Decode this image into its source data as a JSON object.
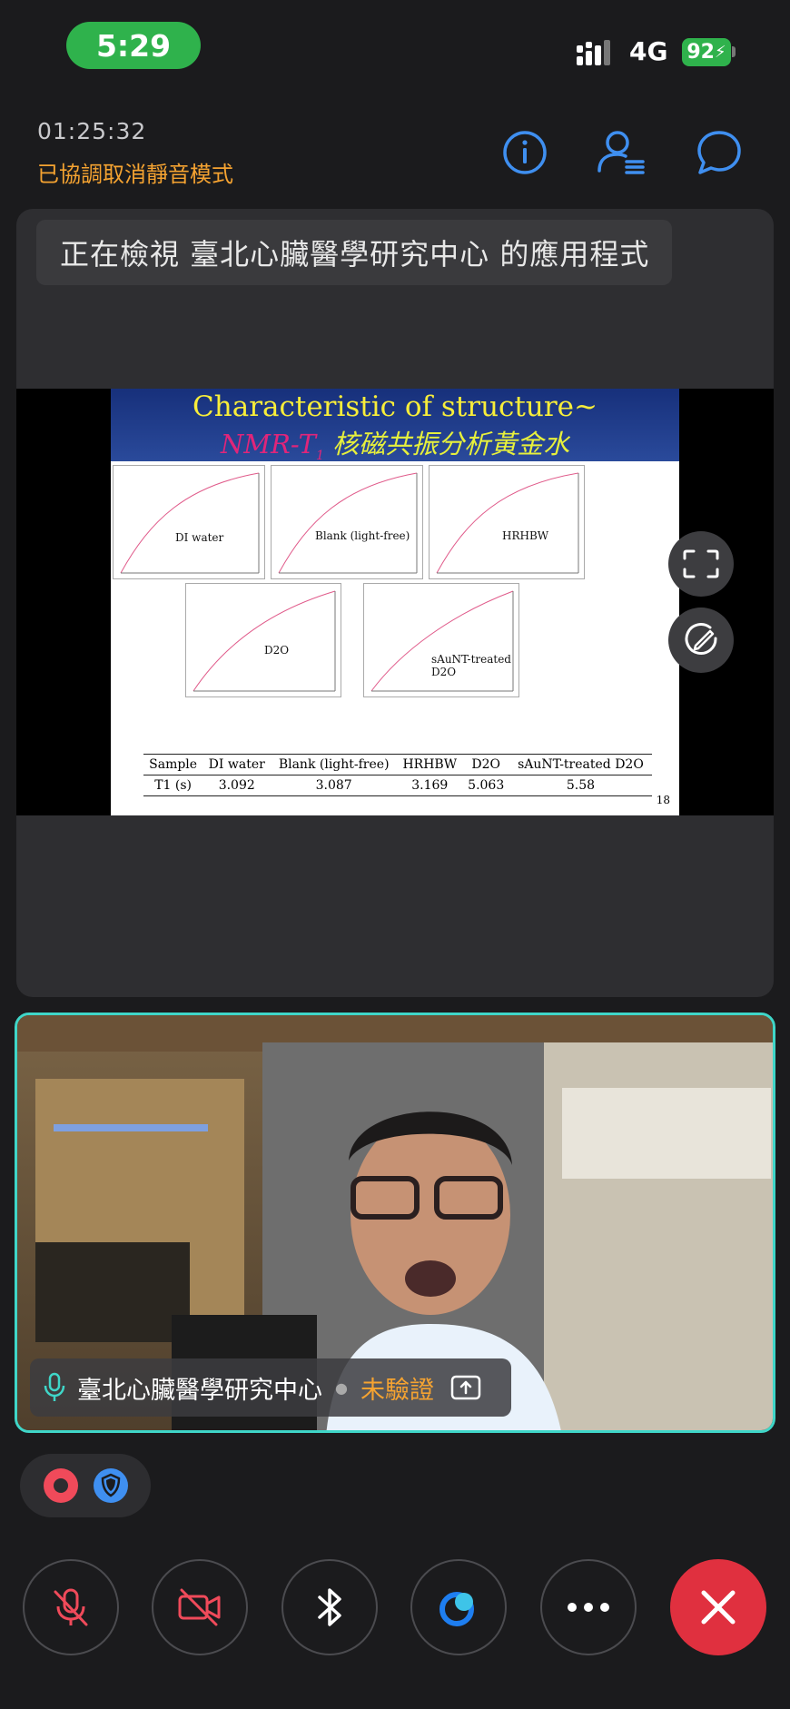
{
  "status_bar": {
    "time": "5:29",
    "network": "4G",
    "battery": "92"
  },
  "header": {
    "duration": "01:25:32",
    "unmute_notice": "已協調取消靜音模式"
  },
  "share": {
    "banner": "正在檢視 臺北心臟醫學研究中心 的應用程式",
    "slide": {
      "title_line1": "Characteristic of structure~",
      "title_nmr": "NMR-T",
      "title_nmr_sub": "1",
      "title_zh": " 核磁共振分析黃金水",
      "plots": [
        {
          "label": "DI water"
        },
        {
          "label": "Blank (light-free)"
        },
        {
          "label": "HRHBW"
        },
        {
          "label": "D2O"
        },
        {
          "label": "sAuNT-treated D2O"
        }
      ],
      "table": {
        "headers": [
          "Sample",
          "DI water",
          "Blank (light-free)",
          "HRHBW",
          "D2O",
          "sAuNT-treated D2O"
        ],
        "row_label": "T1 (s)",
        "values": [
          "3.092",
          "3.087",
          "3.169",
          "5.063",
          "5.58"
        ]
      },
      "page": "18"
    }
  },
  "video": {
    "participant": "臺北心臟醫學研究中心",
    "verification": "未驗證"
  },
  "colors": {
    "accent_blue": "#3f8ff0",
    "unmute_orange": "#f5a331",
    "end_red": "#e0303f",
    "status_green": "#2fb24c",
    "tile_border": "#3fd6c8"
  },
  "icons": {
    "header": [
      "info-icon",
      "participants-icon",
      "chat-icon"
    ],
    "controls": [
      "mic-off-icon",
      "video-off-icon",
      "bluetooth-icon",
      "teams-icon",
      "more-icon",
      "end-call-icon"
    ]
  }
}
